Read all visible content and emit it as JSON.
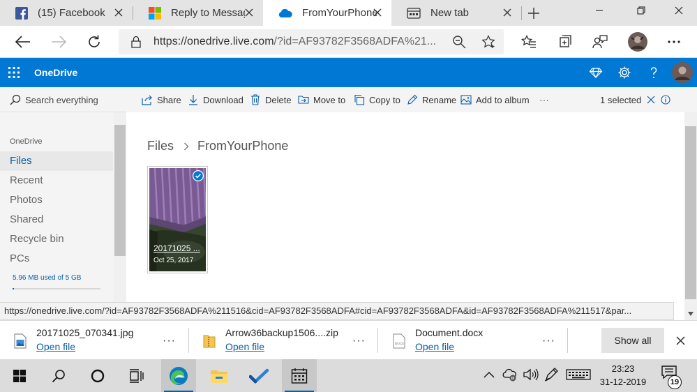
{
  "browser": {
    "tabs": [
      {
        "label": "(15) Facebook",
        "icon": "facebook-icon"
      },
      {
        "label": "Reply to Message",
        "icon": "microsoft-icon"
      },
      {
        "label": "FromYourPhone - ",
        "icon": "onedrive-cloud-icon"
      },
      {
        "label": "New tab",
        "icon": "new-tab-icon"
      }
    ],
    "url_host": "https://onedrive.live.com",
    "url_rest": "/?id=AF93782F3568ADFA%21..."
  },
  "onedrive": {
    "app_title": "OneDrive",
    "search_placeholder": "Search everything",
    "nav_heading": "OneDrive",
    "nav_items": [
      "Files",
      "Recent",
      "Photos",
      "Shared",
      "Recycle bin",
      "PCs"
    ],
    "selected_nav": "Files",
    "storage_text": "5.96 MB used of 5 GB",
    "storage_used_fraction": 0.0012,
    "commands": [
      "Share",
      "Download",
      "Delete",
      "Move to",
      "Copy to",
      "Rename",
      "Add to album"
    ],
    "more_label": "···",
    "selection_text": "1 selected",
    "breadcrumb": [
      "Files",
      "FromYourPhone"
    ],
    "file": {
      "name": "20171025 ...",
      "date": "Oct 25, 2017"
    }
  },
  "status_url": "https://onedrive.live.com/?id=AF93782F3568ADFA%211516&cid=AF93782F3568ADFA#cid=AF93782F3568ADFA&id=AF93782F3568ADFA%211517&par...",
  "downloads": [
    {
      "name": "20171025_070341.jpg",
      "action": "Open file"
    },
    {
      "name": "Arrow36backup1506....zip",
      "action": "Open file"
    },
    {
      "name": "Document.docx",
      "action": "Open file"
    }
  ],
  "downloads_more": "···",
  "show_all_label": "Show all",
  "taskbar": {
    "time": "23:23",
    "date": "31-12-2019",
    "notification_count": "19"
  },
  "colors": {
    "accent": "#0078d4",
    "link": "#0a5ea8"
  }
}
